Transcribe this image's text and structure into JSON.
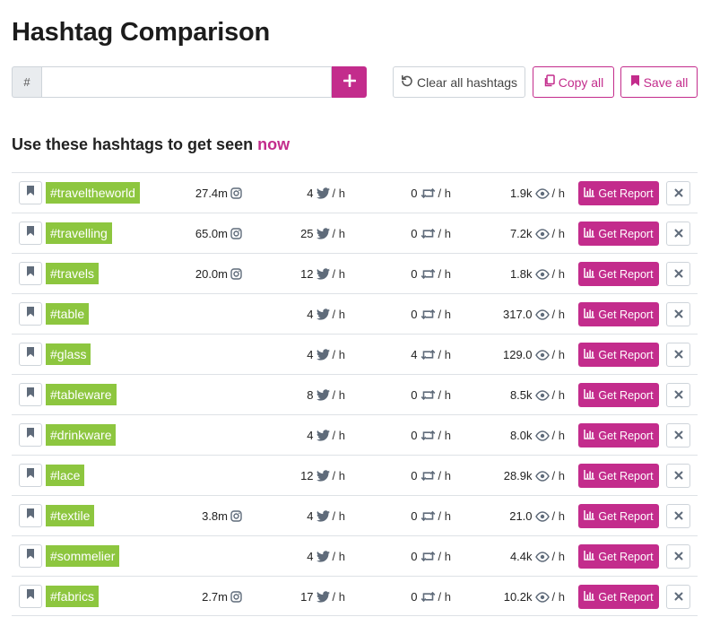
{
  "page": {
    "title": "Hashtag Comparison"
  },
  "search": {
    "prefix": "#",
    "value": "",
    "placeholder": "",
    "add_icon": "plus-icon"
  },
  "toolbar": {
    "clear_label": "Clear all hashtags",
    "clear_icon": "undo-icon",
    "copy_label": "Copy all",
    "copy_icon": "copy-icon",
    "save_label": "Save all",
    "save_icon": "bookmark-icon"
  },
  "subtitle": {
    "text": "Use these hashtags to get seen",
    "accent": "now"
  },
  "colors": {
    "accent": "#c32c8c",
    "tag_green": "#8dc63f",
    "icon_gray": "#5f6b7a"
  },
  "labels": {
    "per_hour": "/ h",
    "report": "Get Report"
  },
  "hashtags": [
    {
      "tag": "#traveltheworld",
      "instagram": "27.4m",
      "tweets": "4",
      "retweets": "0",
      "views": "1.9k"
    },
    {
      "tag": "#travelling",
      "instagram": "65.0m",
      "tweets": "25",
      "retweets": "0",
      "views": "7.2k"
    },
    {
      "tag": "#travels",
      "instagram": "20.0m",
      "tweets": "12",
      "retweets": "0",
      "views": "1.8k"
    },
    {
      "tag": "#table",
      "instagram": "",
      "tweets": "4",
      "retweets": "0",
      "views": "317.0"
    },
    {
      "tag": "#glass",
      "instagram": "",
      "tweets": "4",
      "retweets": "4",
      "views": "129.0"
    },
    {
      "tag": "#tableware",
      "instagram": "",
      "tweets": "8",
      "retweets": "0",
      "views": "8.5k"
    },
    {
      "tag": "#drinkware",
      "instagram": "",
      "tweets": "4",
      "retweets": "0",
      "views": "8.0k"
    },
    {
      "tag": "#lace",
      "instagram": "",
      "tweets": "12",
      "retweets": "0",
      "views": "28.9k"
    },
    {
      "tag": "#textile",
      "instagram": "3.8m",
      "tweets": "4",
      "retweets": "0",
      "views": "21.0"
    },
    {
      "tag": "#sommelier",
      "instagram": "",
      "tweets": "4",
      "retweets": "0",
      "views": "4.4k"
    },
    {
      "tag": "#fabrics",
      "instagram": "2.7m",
      "tweets": "17",
      "retweets": "0",
      "views": "10.2k"
    }
  ]
}
